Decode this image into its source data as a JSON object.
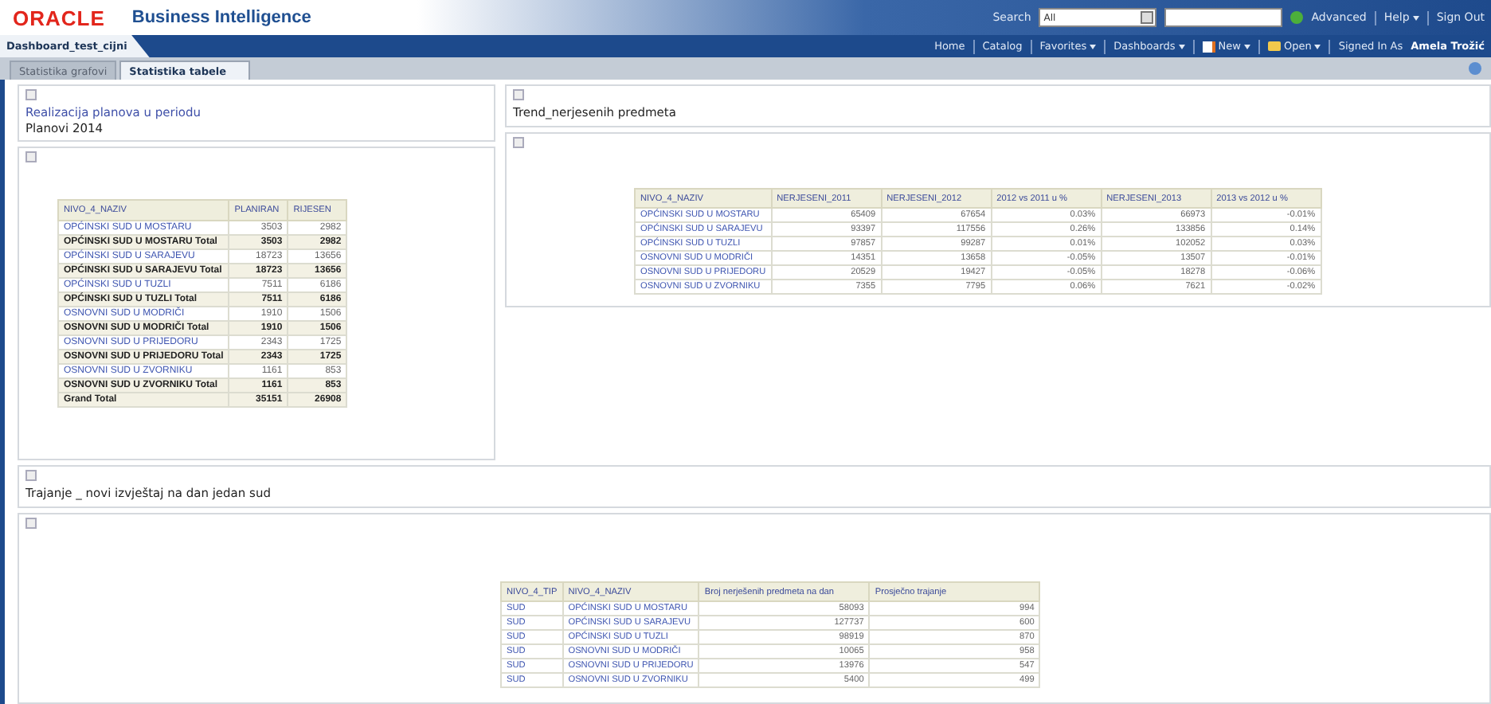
{
  "header": {
    "logo": "ORACLE",
    "product": "Business Intelligence",
    "search_label": "Search",
    "search_scope": "All",
    "links": [
      {
        "label": "Advanced",
        "menu": false
      },
      {
        "label": "Help",
        "menu": true
      },
      {
        "label": "Sign Out",
        "menu": false
      }
    ]
  },
  "nav": {
    "dashboard": "Dashboard_test_cijni",
    "items": [
      {
        "label": "Home",
        "menu": false,
        "kind": "plain"
      },
      {
        "label": "Catalog",
        "menu": false,
        "kind": "plain"
      },
      {
        "label": "Favorites",
        "menu": true,
        "kind": "plain"
      },
      {
        "label": "Dashboards",
        "menu": true,
        "kind": "plain"
      },
      {
        "label": "New",
        "menu": true,
        "kind": "document"
      },
      {
        "label": "Open",
        "menu": true,
        "kind": "folder"
      }
    ],
    "signed_in_label": "Signed In As",
    "user": "Amela Trožić"
  },
  "tabs": [
    {
      "label": "Statistika grafovi",
      "selected": false
    },
    {
      "label": "Statistika tabele",
      "selected": true
    }
  ],
  "left_panel": {
    "title": "Realizacija planova u periodu",
    "subtitle": "Planovi 2014",
    "table": {
      "columns": [
        {
          "label": "NIVO_4_NAZIV",
          "kind": "text"
        },
        {
          "label": "PLANIRAN",
          "kind": "number"
        },
        {
          "label": "RIJESEN",
          "kind": "number"
        }
      ],
      "rows": [
        {
          "kind": "item",
          "cells": [
            "OPĆINSKI SUD U MOSTARU",
            "3503",
            "2982"
          ]
        },
        {
          "kind": "total",
          "cells": [
            "OPĆINSKI SUD U MOSTARU Total",
            "3503",
            "2982"
          ]
        },
        {
          "kind": "item",
          "cells": [
            "OPĆINSKI SUD U SARAJEVU",
            "18723",
            "13656"
          ]
        },
        {
          "kind": "total",
          "cells": [
            "OPĆINSKI SUD U SARAJEVU Total",
            "18723",
            "13656"
          ]
        },
        {
          "kind": "item",
          "cells": [
            "OPĆINSKI SUD U TUZLI",
            "7511",
            "6186"
          ]
        },
        {
          "kind": "total",
          "cells": [
            "OPĆINSKI SUD U TUZLI Total",
            "7511",
            "6186"
          ]
        },
        {
          "kind": "item",
          "cells": [
            "OSNOVNI SUD U MODRIČI",
            "1910",
            "1506"
          ]
        },
        {
          "kind": "total",
          "cells": [
            "OSNOVNI SUD U MODRIČI Total",
            "1910",
            "1506"
          ]
        },
        {
          "kind": "item",
          "cells": [
            "OSNOVNI SUD U PRIJEDORU",
            "2343",
            "1725"
          ]
        },
        {
          "kind": "total",
          "cells": [
            "OSNOVNI SUD U PRIJEDORU Total",
            "2343",
            "1725"
          ]
        },
        {
          "kind": "item",
          "cells": [
            "OSNOVNI SUD U ZVORNIKU",
            "1161",
            "853"
          ]
        },
        {
          "kind": "total",
          "cells": [
            "OSNOVNI SUD U ZVORNIKU Total",
            "1161",
            "853"
          ]
        },
        {
          "kind": "total",
          "cells": [
            "Grand Total",
            "35151",
            "26908"
          ]
        }
      ]
    }
  },
  "right_panel": {
    "title": "Trend_nerjesenih predmeta",
    "table": {
      "columns": [
        {
          "label": "NIVO_4_NAZIV",
          "kind": "text"
        },
        {
          "label": "NERJESENI_2011",
          "kind": "number"
        },
        {
          "label": "NERJESENI_2012",
          "kind": "number"
        },
        {
          "label": "2012 vs 2011 u %",
          "kind": "number"
        },
        {
          "label": "NERJESENI_2013",
          "kind": "number"
        },
        {
          "label": "2013 vs 2012 u %",
          "kind": "number"
        }
      ],
      "rows": [
        {
          "kind": "item",
          "cells": [
            "OPĆINSKI SUD U MOSTARU",
            "65409",
            "67654",
            "0.03%",
            "66973",
            "-0.01%"
          ]
        },
        {
          "kind": "item",
          "cells": [
            "OPĆINSKI SUD U SARAJEVU",
            "93397",
            "117556",
            "0.26%",
            "133856",
            "0.14%"
          ]
        },
        {
          "kind": "item",
          "cells": [
            "OPĆINSKI SUD U TUZLI",
            "97857",
            "99287",
            "0.01%",
            "102052",
            "0.03%"
          ]
        },
        {
          "kind": "item",
          "cells": [
            "OSNOVNI SUD U MODRIČI",
            "14351",
            "13658",
            "-0.05%",
            "13507",
            "-0.01%"
          ]
        },
        {
          "kind": "item",
          "cells": [
            "OSNOVNI SUD U PRIJEDORU",
            "20529",
            "19427",
            "-0.05%",
            "18278",
            "-0.06%"
          ]
        },
        {
          "kind": "item",
          "cells": [
            "OSNOVNI SUD U ZVORNIKU",
            "7355",
            "7795",
            "0.06%",
            "7621",
            "-0.02%"
          ]
        }
      ]
    }
  },
  "bottom_panel": {
    "title": "Trajanje _ novi izvještaj na dan jedan sud",
    "table": {
      "columns": [
        {
          "label": "NIVO_4_TIP",
          "kind": "text"
        },
        {
          "label": "NIVO_4_NAZIV",
          "kind": "text"
        },
        {
          "label": "Broj nerješenih predmeta na dan",
          "kind": "number"
        },
        {
          "label": "Prosječno trajanje",
          "kind": "number"
        }
      ],
      "rows": [
        {
          "kind": "item",
          "cells": [
            "SUD",
            "OPĆINSKI SUD U MOSTARU",
            "58093",
            "994"
          ]
        },
        {
          "kind": "item",
          "cells": [
            "SUD",
            "OPĆINSKI SUD U SARAJEVU",
            "127737",
            "600"
          ]
        },
        {
          "kind": "item",
          "cells": [
            "SUD",
            "OPĆINSKI SUD U TUZLI",
            "98919",
            "870"
          ]
        },
        {
          "kind": "item",
          "cells": [
            "SUD",
            "OSNOVNI SUD U MODRIČI",
            "10065",
            "958"
          ]
        },
        {
          "kind": "item",
          "cells": [
            "SUD",
            "OSNOVNI SUD U PRIJEDORU",
            "13976",
            "547"
          ]
        },
        {
          "kind": "item",
          "cells": [
            "SUD",
            "OSNOVNI SUD U ZVORNIKU",
            "5400",
            "499"
          ]
        }
      ]
    }
  }
}
